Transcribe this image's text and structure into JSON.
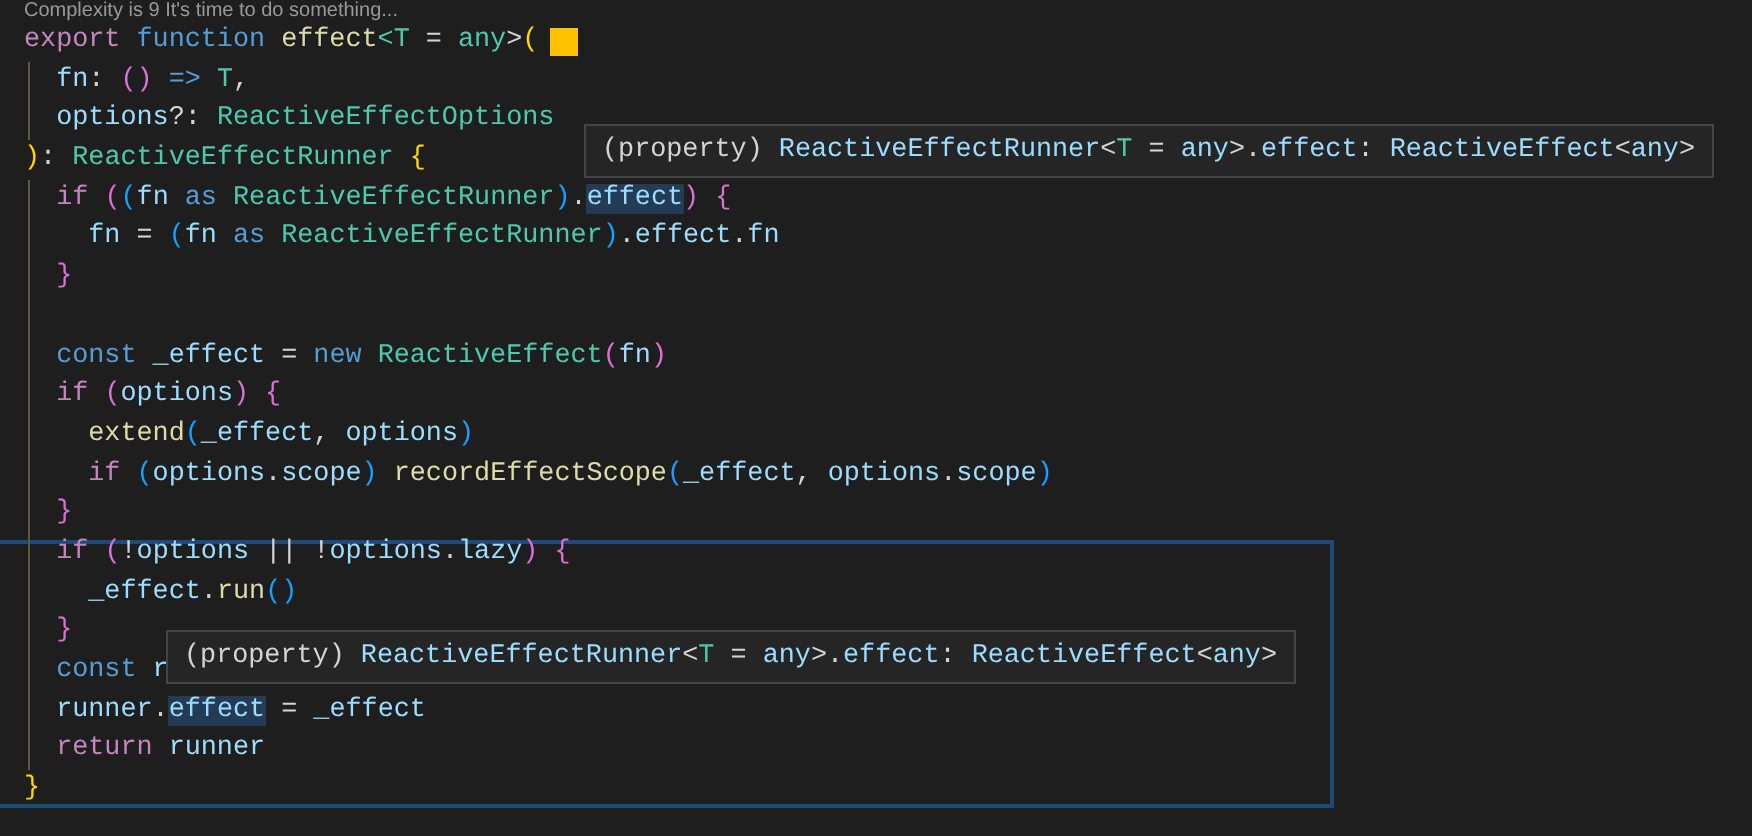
{
  "codelens": "Complexity is 9 It's time to do something...",
  "lines": [
    {
      "tokens": [
        {
          "kind": "control",
          "text": "export "
        },
        {
          "kind": "storage",
          "text": "function "
        },
        {
          "kind": "function",
          "text": "effect"
        },
        {
          "kind": "type",
          "text": "<T"
        },
        {
          "kind": "plain",
          "text": " = "
        },
        {
          "kind": "type",
          "text": "any"
        },
        {
          "kind": "plain",
          "text": ">"
        },
        {
          "kind": "bracket1",
          "text": "("
        }
      ],
      "swatch": true
    },
    {
      "tokens": [
        {
          "kind": "param",
          "text": "  fn"
        },
        {
          "kind": "plain",
          "text": ": "
        },
        {
          "kind": "bracket2",
          "text": "() "
        },
        {
          "kind": "storage",
          "text": "=> "
        },
        {
          "kind": "type",
          "text": "T"
        },
        {
          "kind": "plain",
          "text": ","
        }
      ]
    },
    {
      "tokens": [
        {
          "kind": "param",
          "text": "  options"
        },
        {
          "kind": "plain",
          "text": "?: "
        },
        {
          "kind": "type",
          "text": "ReactiveEffectOptions"
        }
      ]
    },
    {
      "tokens": [
        {
          "kind": "bracket1",
          "text": ")"
        },
        {
          "kind": "plain",
          "text": ": "
        },
        {
          "kind": "type",
          "text": "ReactiveEffectRunner "
        },
        {
          "kind": "bracket1",
          "text": "{"
        }
      ]
    },
    {
      "tokens": [
        {
          "kind": "control",
          "text": "  if "
        },
        {
          "kind": "bracket2",
          "text": "("
        },
        {
          "kind": "bracket3",
          "text": "("
        },
        {
          "kind": "param",
          "text": "fn "
        },
        {
          "kind": "storage",
          "text": "as "
        },
        {
          "kind": "type",
          "text": "ReactiveEffectRunner"
        },
        {
          "kind": "bracket3",
          "text": ")"
        },
        {
          "kind": "plain",
          "text": "."
        },
        {
          "kind": "highlight",
          "text": "effect"
        },
        {
          "kind": "bracket2",
          "text": ") {"
        }
      ]
    },
    {
      "tokens": [
        {
          "kind": "param",
          "text": "    fn"
        },
        {
          "kind": "plain",
          "text": " = "
        },
        {
          "kind": "bracket3",
          "text": "("
        },
        {
          "kind": "param",
          "text": "fn "
        },
        {
          "kind": "storage",
          "text": "as "
        },
        {
          "kind": "type",
          "text": "ReactiveEffectRunner"
        },
        {
          "kind": "bracket3",
          "text": ")"
        },
        {
          "kind": "plain",
          "text": "."
        },
        {
          "kind": "param",
          "text": "effect"
        },
        {
          "kind": "plain",
          "text": "."
        },
        {
          "kind": "param",
          "text": "fn"
        }
      ]
    },
    {
      "tokens": [
        {
          "kind": "bracket2",
          "text": "  }"
        }
      ]
    },
    {
      "kind": "blank"
    },
    {
      "tokens": [
        {
          "kind": "storage",
          "text": "  const "
        },
        {
          "kind": "variable",
          "text": "_effect"
        },
        {
          "kind": "plain",
          "text": " = "
        },
        {
          "kind": "storage",
          "text": "new "
        },
        {
          "kind": "type",
          "text": "ReactiveEffect"
        },
        {
          "kind": "bracket2",
          "text": "("
        },
        {
          "kind": "param",
          "text": "fn"
        },
        {
          "kind": "bracket2",
          "text": ")"
        }
      ]
    },
    {
      "tokens": [
        {
          "kind": "control",
          "text": "  if "
        },
        {
          "kind": "bracket2",
          "text": "("
        },
        {
          "kind": "param",
          "text": "options"
        },
        {
          "kind": "bracket2",
          "text": ") {"
        }
      ]
    },
    {
      "tokens": [
        {
          "kind": "function",
          "text": "    extend"
        },
        {
          "kind": "bracket3",
          "text": "("
        },
        {
          "kind": "variable",
          "text": "_effect"
        },
        {
          "kind": "plain",
          "text": ", "
        },
        {
          "kind": "param",
          "text": "options"
        },
        {
          "kind": "bracket3",
          "text": ")"
        }
      ]
    },
    {
      "tokens": [
        {
          "kind": "control",
          "text": "    if "
        },
        {
          "kind": "bracket3",
          "text": "("
        },
        {
          "kind": "param",
          "text": "options"
        },
        {
          "kind": "plain",
          "text": "."
        },
        {
          "kind": "param",
          "text": "scope"
        },
        {
          "kind": "bracket3",
          "text": ") "
        },
        {
          "kind": "function",
          "text": "recordEffectScope"
        },
        {
          "kind": "bracket3",
          "text": "("
        },
        {
          "kind": "variable",
          "text": "_effect"
        },
        {
          "kind": "plain",
          "text": ", "
        },
        {
          "kind": "param",
          "text": "options"
        },
        {
          "kind": "plain",
          "text": "."
        },
        {
          "kind": "param",
          "text": "scope"
        },
        {
          "kind": "bracket3",
          "text": ")"
        }
      ]
    },
    {
      "tokens": [
        {
          "kind": "bracket2",
          "text": "  }"
        }
      ]
    },
    {
      "tokens": [
        {
          "kind": "control",
          "text": "  if "
        },
        {
          "kind": "bracket2",
          "text": "("
        },
        {
          "kind": "plain",
          "text": "!"
        },
        {
          "kind": "param",
          "text": "options"
        },
        {
          "kind": "plain",
          "text": " || !"
        },
        {
          "kind": "param",
          "text": "options"
        },
        {
          "kind": "plain",
          "text": "."
        },
        {
          "kind": "param",
          "text": "lazy"
        },
        {
          "kind": "bracket2",
          "text": ") {"
        }
      ]
    },
    {
      "tokens": [
        {
          "kind": "variable",
          "text": "    _effect"
        },
        {
          "kind": "plain",
          "text": "."
        },
        {
          "kind": "function",
          "text": "run"
        },
        {
          "kind": "bracket3",
          "text": "()"
        }
      ]
    },
    {
      "tokens": [
        {
          "kind": "bracket2",
          "text": "  }"
        }
      ]
    },
    {
      "tokens": [
        {
          "kind": "storage",
          "text": "  const "
        },
        {
          "kind": "variable",
          "text": "r"
        }
      ]
    },
    {
      "tokens": [
        {
          "kind": "variable",
          "text": "  runner"
        },
        {
          "kind": "plain",
          "text": "."
        },
        {
          "kind": "highlight",
          "text": "effect"
        },
        {
          "kind": "plain",
          "text": " = "
        },
        {
          "kind": "variable",
          "text": "_effect"
        }
      ]
    },
    {
      "tokens": [
        {
          "kind": "control",
          "text": "  return "
        },
        {
          "kind": "variable",
          "text": "runner"
        }
      ]
    },
    {
      "tokens": [
        {
          "kind": "bracket1",
          "text": "}"
        }
      ]
    }
  ],
  "hovers": [
    {
      "tokens": [
        {
          "kind": "plain",
          "text": "(property) "
        },
        {
          "kind": "variable",
          "text": "ReactiveEffectRunner"
        },
        {
          "kind": "plain",
          "text": "<"
        },
        {
          "kind": "type",
          "text": "T"
        },
        {
          "kind": "plain",
          "text": " = "
        },
        {
          "kind": "variable",
          "text": "any"
        },
        {
          "kind": "plain",
          "text": ">."
        },
        {
          "kind": "variable",
          "text": "effect"
        },
        {
          "kind": "plain",
          "text": ": "
        },
        {
          "kind": "variable",
          "text": "ReactiveEffect"
        },
        {
          "kind": "plain",
          "text": "<"
        },
        {
          "kind": "variable",
          "text": "any"
        },
        {
          "kind": "plain",
          "text": ">"
        }
      ]
    },
    {
      "tokens": [
        {
          "kind": "plain",
          "text": "(property) "
        },
        {
          "kind": "variable",
          "text": "ReactiveEffectRunner"
        },
        {
          "kind": "plain",
          "text": "<"
        },
        {
          "kind": "type",
          "text": "T"
        },
        {
          "kind": "plain",
          "text": " = "
        },
        {
          "kind": "variable",
          "text": "any"
        },
        {
          "kind": "plain",
          "text": ">."
        },
        {
          "kind": "variable",
          "text": "effect"
        },
        {
          "kind": "plain",
          "text": ": "
        },
        {
          "kind": "variable",
          "text": "ReactiveEffect"
        },
        {
          "kind": "plain",
          "text": "<"
        },
        {
          "kind": "variable",
          "text": "any"
        },
        {
          "kind": "plain",
          "text": ">"
        }
      ]
    }
  ]
}
